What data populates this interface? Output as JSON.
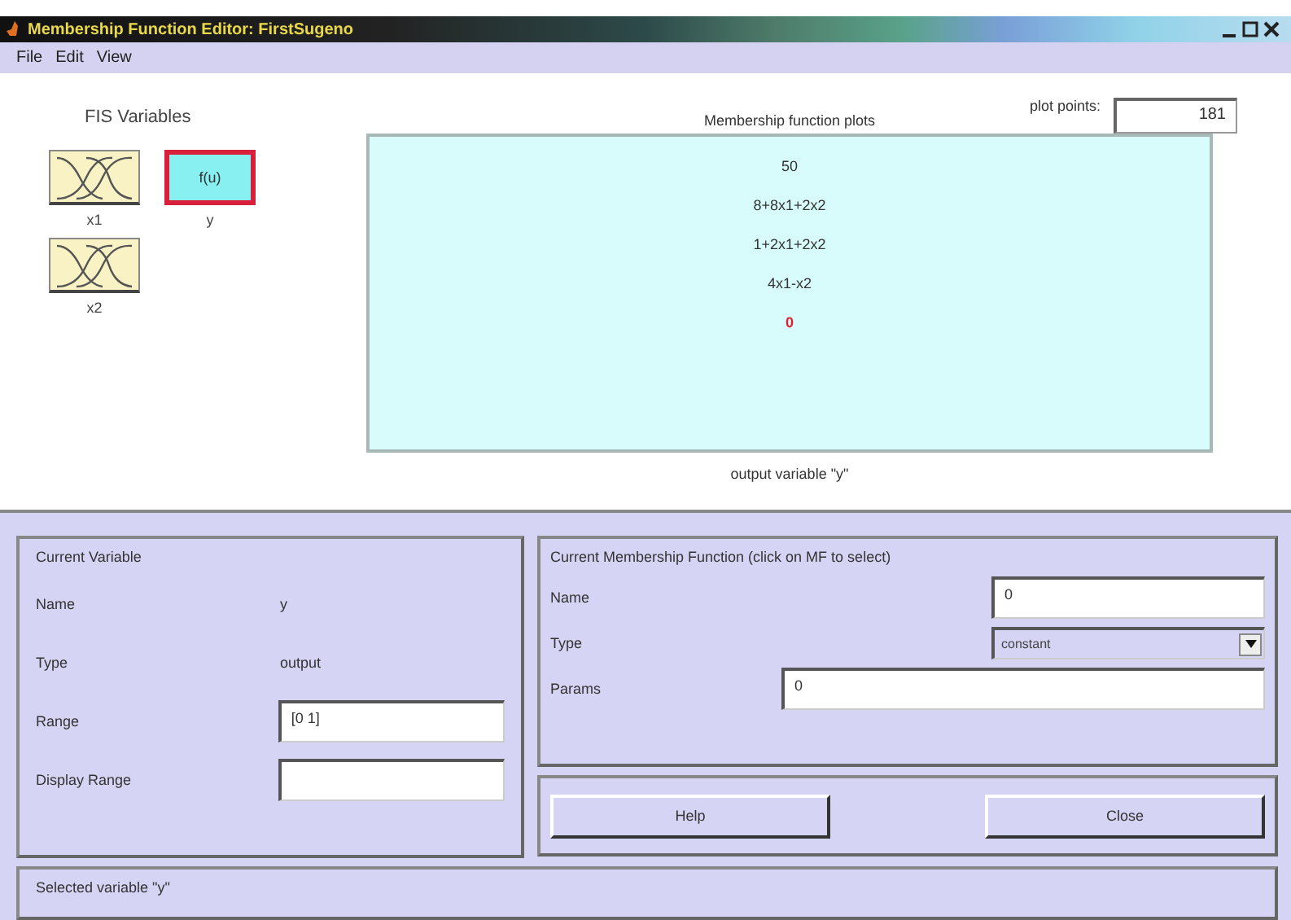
{
  "window": {
    "title": "Membership Function Editor: FirstSugeno"
  },
  "menu": [
    "File",
    "Edit",
    "View"
  ],
  "fis_variables": {
    "title": "FIS Variables",
    "items": [
      {
        "name": "x1",
        "kind": "input",
        "selected": false
      },
      {
        "name": "y",
        "kind": "output",
        "icon_label": "f(u)",
        "selected": true
      },
      {
        "name": "x2",
        "kind": "input",
        "selected": false
      }
    ]
  },
  "plot": {
    "title": "Membership function plots",
    "plot_points_label": "plot points:",
    "plot_points": "181",
    "caption": "output variable \"y\"",
    "mfs": [
      {
        "label": "50",
        "selected": false
      },
      {
        "label": "8+8x1+2x2",
        "selected": false
      },
      {
        "label": "1+2x1+2x2",
        "selected": false
      },
      {
        "label": "4x1-x2",
        "selected": false
      },
      {
        "label": "0",
        "selected": true
      }
    ]
  },
  "current_variable": {
    "title": "Current Variable",
    "fields": [
      {
        "label": "Name",
        "kind": "text",
        "value": "y"
      },
      {
        "label": "Type",
        "kind": "text",
        "value": "output"
      },
      {
        "label": "Range",
        "kind": "input",
        "value": "[0 1]"
      },
      {
        "label": "Display Range",
        "kind": "input"
      }
    ]
  },
  "current_mf": {
    "title": "Current Membership Function (click on MF to select)",
    "fields": [
      {
        "label": "Name",
        "kind": "input",
        "value": "0"
      },
      {
        "label": "Type",
        "kind": "dropdown",
        "value": "constant"
      },
      {
        "label": "Params",
        "kind": "wide-input",
        "value": "0"
      }
    ]
  },
  "buttons": [
    "Help",
    "Close"
  ],
  "status": "Selected variable \"y\""
}
